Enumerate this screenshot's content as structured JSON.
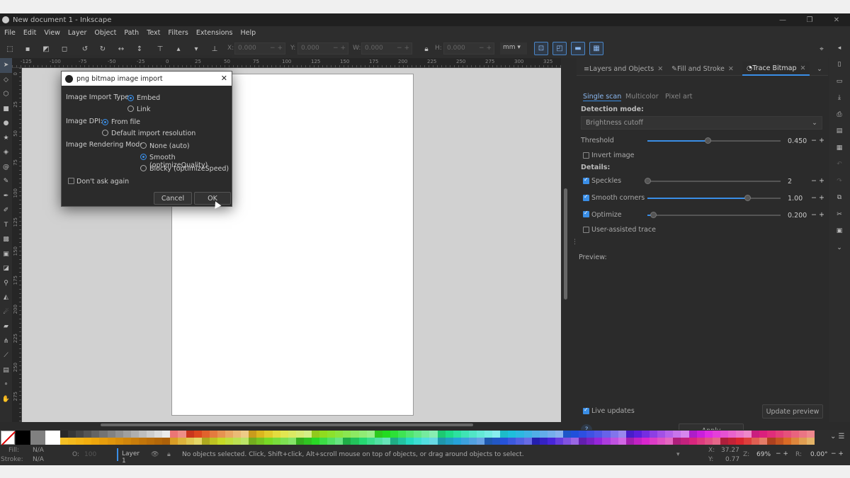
{
  "window": {
    "title": "New document 1 - Inkscape",
    "controls": [
      "—",
      "❐",
      "✕"
    ]
  },
  "menu": [
    "File",
    "Edit",
    "View",
    "Layer",
    "Object",
    "Path",
    "Text",
    "Filters",
    "Extensions",
    "Help"
  ],
  "toolbar": {
    "x_label": "X:",
    "x_value": "0.000",
    "y_label": "Y:",
    "y_value": "0.000",
    "w_label": "W:",
    "w_value": "0.000",
    "h_label": "H:",
    "h_value": "0.000",
    "unit": "mm"
  },
  "ruler": {
    "top_ticks": [
      "-125",
      "-100",
      "-75",
      "-50",
      "-25",
      "0",
      "25",
      "50",
      "75",
      "100",
      "125",
      "150",
      "175",
      "200",
      "225",
      "250",
      "275",
      "300",
      "325"
    ],
    "left_ticks": [
      "0",
      "25",
      "50",
      "75",
      "100",
      "125",
      "150",
      "175",
      "200",
      "225",
      "250",
      "275"
    ]
  },
  "dialog": {
    "title": "png bitmap image import",
    "import_type_label": "Image Import Type:",
    "embed_label": "Embed",
    "link_label": "Link",
    "dpi_label": "Image DPI:",
    "from_file_label": "From file",
    "default_res_label": "Default import resolution",
    "rendering_label": "Image Rendering Mode:",
    "none_auto_label": "None (auto)",
    "smooth_label": "Smooth (optimizeQuality)",
    "blocky_label": "Blocky (optimizeSpeed)",
    "dont_ask_label": "Don't ask again",
    "cancel_label": "Cancel",
    "ok_label": "OK",
    "close_glyph": "✕"
  },
  "dock": {
    "tabs": [
      {
        "label": "Layers and Objects",
        "icon": "layers-icon"
      },
      {
        "label": "Fill and Stroke",
        "icon": "fill-stroke-icon"
      },
      {
        "label": "Trace Bitmap",
        "icon": "trace-bitmap-icon"
      }
    ],
    "subtabs": [
      "Single scan",
      "Multicolor",
      "Pixel art"
    ],
    "detection_mode_label": "Detection mode:",
    "detection_mode_value": "Brightness cutoff",
    "threshold_label": "Threshold",
    "threshold_value": "0.450",
    "threshold_level": 0.45,
    "invert_label": "Invert image",
    "details_label": "Details:",
    "speckles_label": "Speckles",
    "speckles_value": "2",
    "speckles_level": 0.0,
    "smooth_corners_label": "Smooth corners",
    "smooth_corners_value": "1.00",
    "smooth_corners_level": 0.75,
    "optimize_label": "Optimize",
    "optimize_value": "0.200",
    "optimize_level": 0.04,
    "user_assisted_label": "User-assisted trace",
    "preview_label": "Preview:",
    "live_updates_label": "Live updates",
    "update_preview_label": "Update preview",
    "apply_label": "Apply",
    "spin_glyphs": "−  +"
  },
  "status": {
    "fill_label": "Fill:",
    "fill_value": "N/A",
    "stroke_label": "Stroke:",
    "stroke_value": "N/A",
    "opacity_label": "O:",
    "opacity_value": "100",
    "layer_name": "Layer 1",
    "message": "No objects selected. Click, Shift+click, Alt+scroll mouse on top of objects, or drag around objects to select.",
    "x_label": "X:",
    "x_value": "37.27",
    "y_label": "Y:",
    "y_value": "0.77",
    "zoom_label": "Z:",
    "zoom_value": "69%",
    "rotate_label": "R:",
    "rotate_value": "0.00°"
  },
  "colors": {
    "accent": "#3a8ee6",
    "app_bg": "#2b2b2b",
    "canvas_bg": "#d1d1d1",
    "page_bg": "#ffffff"
  }
}
